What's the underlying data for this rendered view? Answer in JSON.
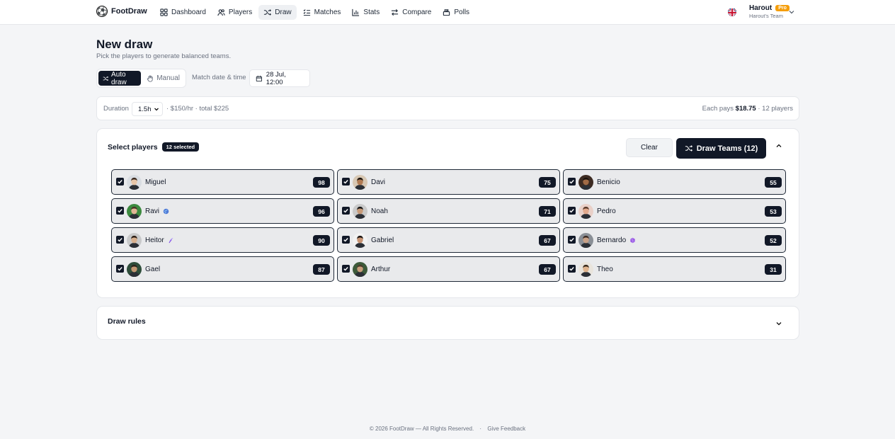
{
  "brand": {
    "name": "FootDraw"
  },
  "nav": [
    {
      "label": "Dashboard",
      "icon": "dashboard-icon",
      "active": false
    },
    {
      "label": "Players",
      "icon": "users-icon",
      "active": false
    },
    {
      "label": "Draw",
      "icon": "shuffle-icon",
      "active": true
    },
    {
      "label": "Matches",
      "icon": "list-checks-icon",
      "active": false
    },
    {
      "label": "Stats",
      "icon": "bar-chart-icon",
      "active": false
    },
    {
      "label": "Compare",
      "icon": "arrows-swap-icon",
      "active": false
    },
    {
      "label": "Polls",
      "icon": "ballot-icon",
      "active": false
    }
  ],
  "user": {
    "name": "Harout",
    "plan": "Pro",
    "team": "Harout's Team"
  },
  "page": {
    "title": "New draw",
    "subtitle": "Pick the players to generate balanced teams."
  },
  "mode": {
    "auto_label": "Auto draw",
    "manual_label": "Manual",
    "selected": "auto"
  },
  "match": {
    "date_label": "Match date & time",
    "date_value": "28 Jul, 12:00"
  },
  "duration": {
    "label": "Duration",
    "value": "1.5h",
    "price_text": "· $150/hr · total $225",
    "each_pays_label": "Each pays",
    "each_pays_value": "$18.75",
    "players_text": "· 12 players"
  },
  "select": {
    "title": "Select players",
    "badge": "12 selected",
    "clear_label": "Clear",
    "draw_label": "Draw Teams (12)"
  },
  "players": [
    {
      "name": "Miguel",
      "rating": "98",
      "checked": true,
      "skin": "#e8c6a8",
      "hair": "#3b2a1f",
      "bg": "#d9dde2",
      "badge": ""
    },
    {
      "name": "Davi",
      "rating": "75",
      "checked": true,
      "skin": "#b07a52",
      "hair": "#1a120c",
      "bg": "#d7c7b3",
      "badge": ""
    },
    {
      "name": "Benicio",
      "rating": "55",
      "checked": true,
      "skin": "#a06a45",
      "hair": "#18110b",
      "bg": "#3d2b22",
      "badge": ""
    },
    {
      "name": "Ravi",
      "rating": "96",
      "checked": true,
      "skin": "#e0b694",
      "hair": "#4a3326",
      "bg": "#3c8a3f",
      "badge": "globe-badge-icon"
    },
    {
      "name": "Noah",
      "rating": "71",
      "checked": true,
      "skin": "#c79a78",
      "hair": "#151515",
      "bg": "#c9c9c9",
      "badge": ""
    },
    {
      "name": "Pedro",
      "rating": "53",
      "checked": true,
      "skin": "#e2a98d",
      "hair": "#5b3a2a",
      "bg": "#e9d0c8",
      "badge": ""
    },
    {
      "name": "Heitor",
      "rating": "90",
      "checked": true,
      "skin": "#d8b08e",
      "hair": "#2b1e16",
      "bg": "#c8c9ca",
      "badge": "feather-badge-icon"
    },
    {
      "name": "Gabriel",
      "rating": "67",
      "checked": true,
      "skin": "#c89474",
      "hair": "#1b1411",
      "bg": "#f2f2f2",
      "badge": ""
    },
    {
      "name": "Bernardo",
      "rating": "52",
      "checked": true,
      "skin": "#c8a086",
      "hair": "#3a2a22",
      "bg": "#8a8f96",
      "badge": "gem-badge-icon"
    },
    {
      "name": "Gael",
      "rating": "87",
      "checked": true,
      "skin": "#c29772",
      "hair": "#2c241c",
      "bg": "#2e4d3a",
      "badge": ""
    },
    {
      "name": "Arthur",
      "rating": "67",
      "checked": true,
      "skin": "#c99d7b",
      "hair": "#4a3a2a",
      "bg": "#3d5a3a",
      "badge": ""
    },
    {
      "name": "Theo",
      "rating": "31",
      "checked": true,
      "skin": "#e0b48e",
      "hair": "#3a2a1c",
      "bg": "#e9e4dc",
      "badge": ""
    }
  ],
  "rules": {
    "title": "Draw rules"
  },
  "footer": {
    "copyright": "© 2026 FootDraw — All Rights Reserved.",
    "feedback": "Give Feedback"
  },
  "colors": {
    "primary": "#111827",
    "pro_badge": "#f59e0b",
    "page_bg": "#f4f5f7",
    "card_bg": "#ffffff"
  }
}
